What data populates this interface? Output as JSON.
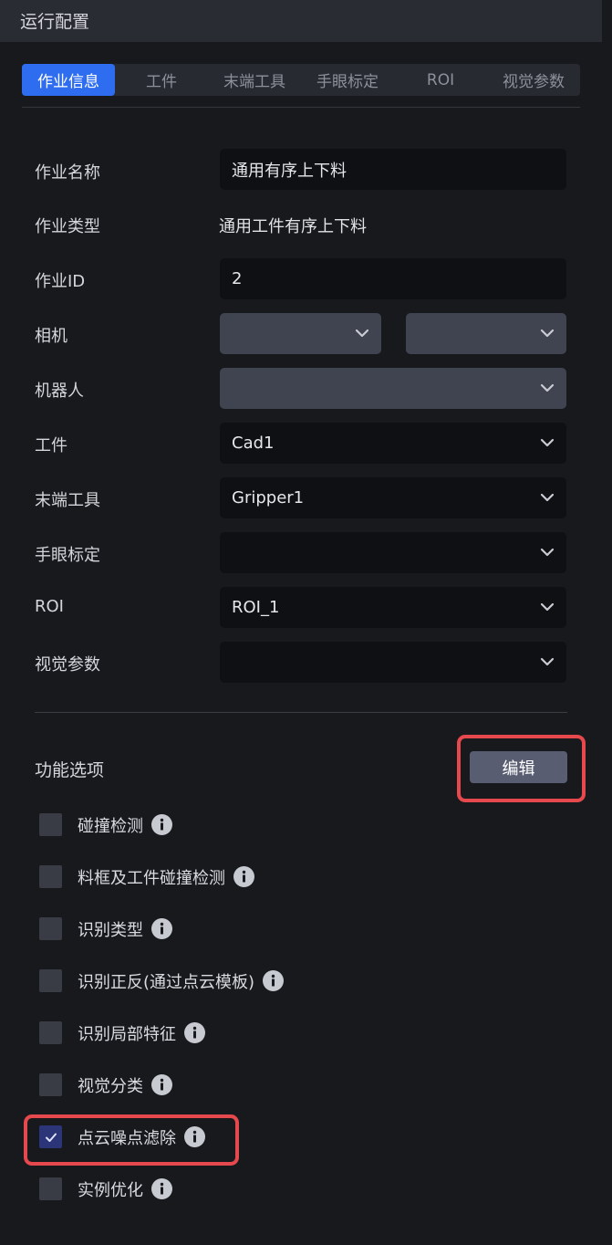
{
  "window": {
    "title": "运行配置"
  },
  "tabs": [
    {
      "label": "作业信息",
      "active": true
    },
    {
      "label": "工件",
      "active": false
    },
    {
      "label": "末端工具",
      "active": false
    },
    {
      "label": "手眼标定",
      "active": false
    },
    {
      "label": "ROI",
      "active": false
    },
    {
      "label": "视觉参数",
      "active": false
    }
  ],
  "form": {
    "job_name": {
      "label": "作业名称",
      "value": "通用有序上下料"
    },
    "job_type": {
      "label": "作业类型",
      "value": "通用工件有序上下料"
    },
    "job_id": {
      "label": "作业ID",
      "value": "2"
    },
    "camera": {
      "label": "相机",
      "value1": "",
      "value2": ""
    },
    "robot": {
      "label": "机器人",
      "value": ""
    },
    "workpiece": {
      "label": "工件",
      "value": "Cad1"
    },
    "end_tool": {
      "label": "末端工具",
      "value": "Gripper1"
    },
    "hand_eye": {
      "label": "手眼标定",
      "value": ""
    },
    "roi": {
      "label": "ROI",
      "value": "ROI_1"
    },
    "vision_params": {
      "label": "视觉参数",
      "value": ""
    }
  },
  "features": {
    "title": "功能选项",
    "edit_label": "编辑",
    "options": [
      {
        "label": "碰撞检测",
        "checked": false
      },
      {
        "label": "料框及工件碰撞检测",
        "checked": false
      },
      {
        "label": "识别类型",
        "checked": false
      },
      {
        "label": "识别正反(通过点云模板)",
        "checked": false
      },
      {
        "label": "识别局部特征",
        "checked": false
      },
      {
        "label": "视觉分类",
        "checked": false
      },
      {
        "label": "点云噪点滤除",
        "checked": true
      },
      {
        "label": "实例优化",
        "checked": false
      }
    ]
  },
  "colors": {
    "accent": "#2f6df0",
    "highlight": "#e5484d",
    "checked_box": "#2b3577"
  },
  "icons": [
    "chevron-down-icon",
    "info-icon",
    "checkmark-icon"
  ]
}
